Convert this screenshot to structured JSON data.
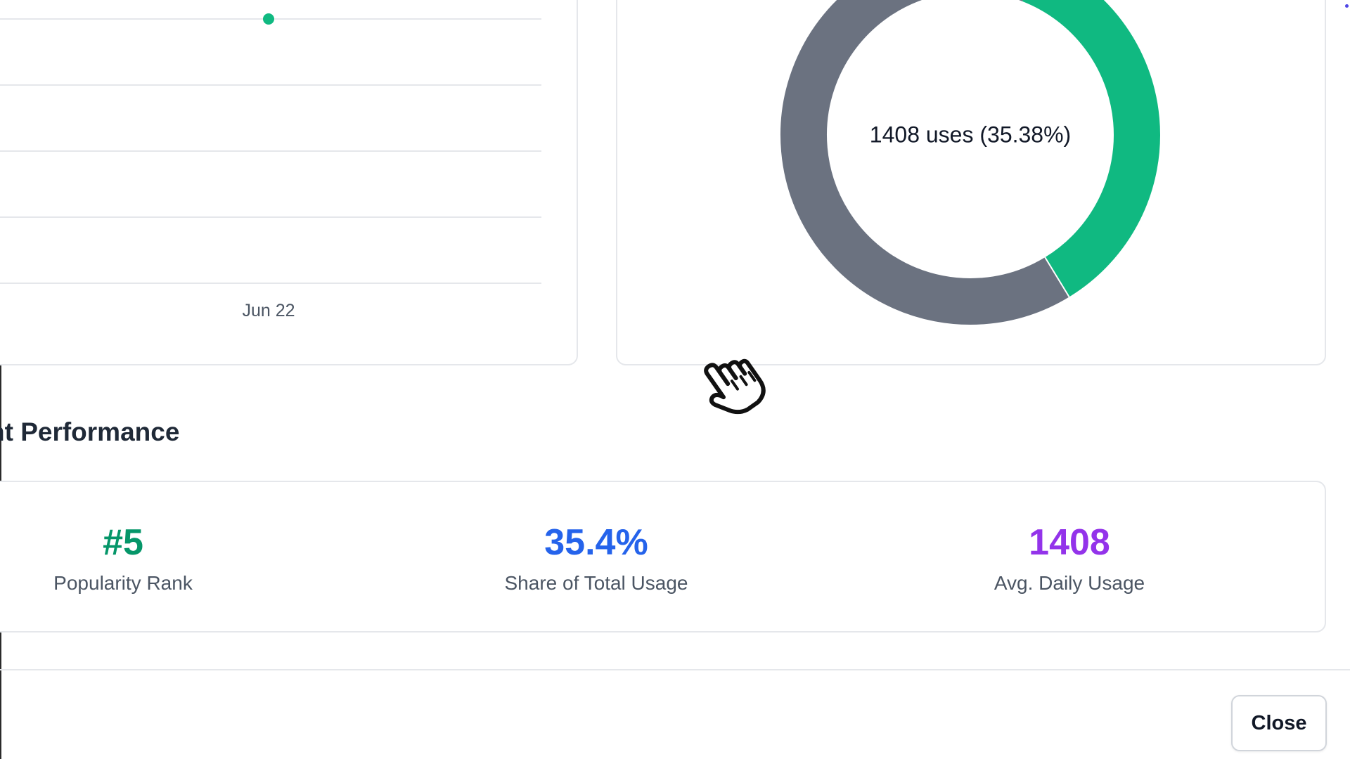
{
  "line_chart": {
    "x_tick_label": "Jun 22"
  },
  "chart_data": [
    {
      "type": "line",
      "x": [
        "Jun 22"
      ],
      "series": [
        {
          "values": [
            1408
          ]
        }
      ],
      "xlabel": "",
      "ylabel": "",
      "grid": true,
      "colors": [
        "#10b981"
      ]
    },
    {
      "type": "pie",
      "center_label": "1408 uses (35.38%)",
      "slices": [
        {
          "value": 35.38
        },
        {
          "value": 64.62
        }
      ],
      "colors": [
        "#10b981",
        "#6b7280"
      ],
      "donut": true
    }
  ],
  "performance": {
    "title": "nt Performance",
    "stats": [
      {
        "value": "#5",
        "label": "Popularity Rank",
        "color": "#059669"
      },
      {
        "value": "35.4%",
        "label": "Share of Total Usage",
        "color": "#2563eb"
      },
      {
        "value": "1408",
        "label": "Avg. Daily Usage",
        "color": "#9333ea"
      }
    ]
  },
  "footer": {
    "close_label": "Close"
  },
  "cursor": {
    "icon": "hand-pointer-icon"
  }
}
